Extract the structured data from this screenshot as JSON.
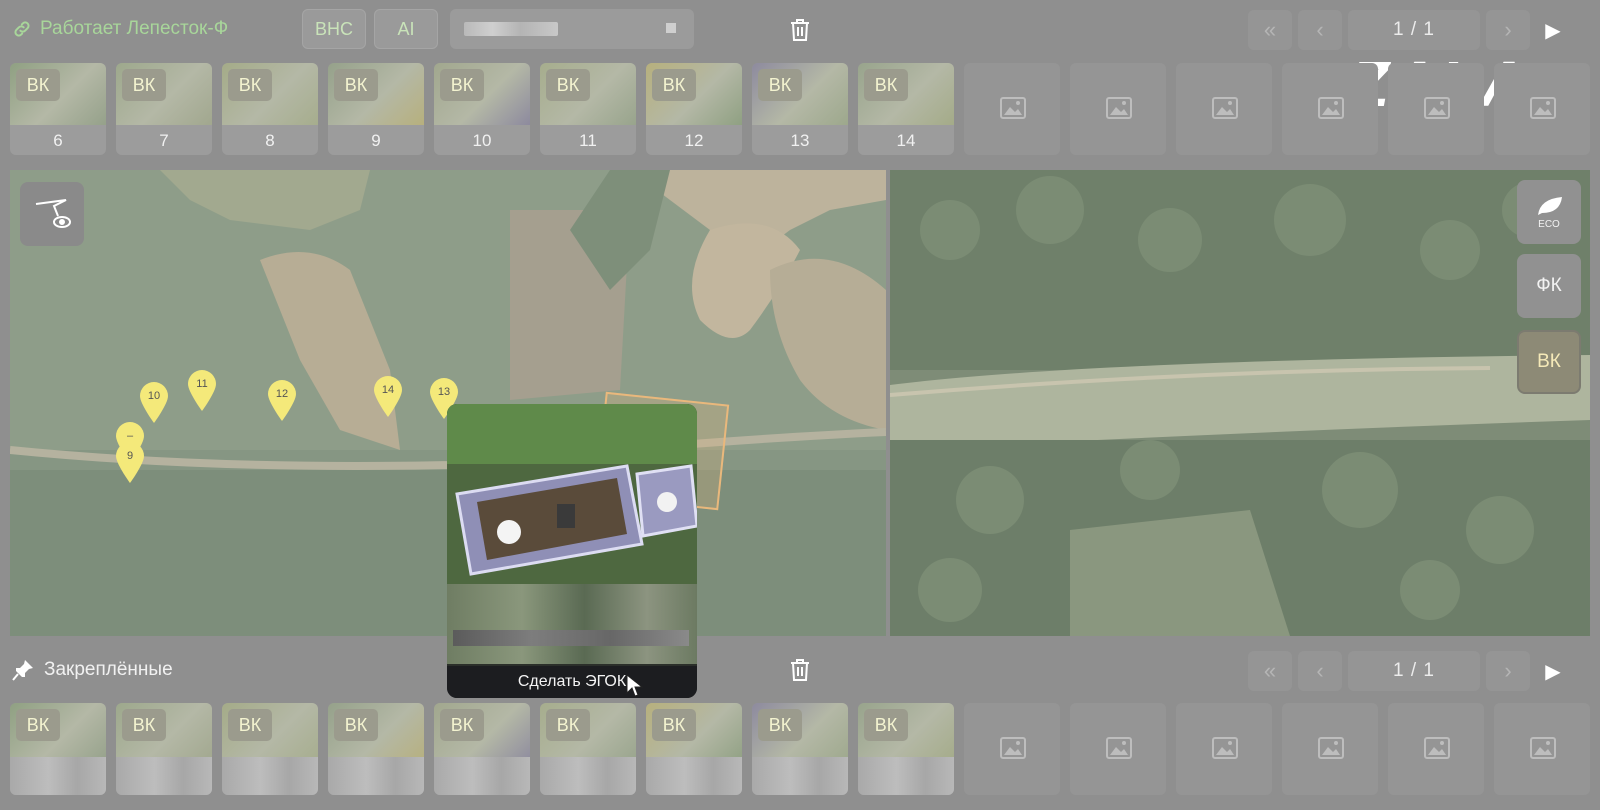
{
  "header": {
    "status_text": "Работает Лепесток-Ф",
    "bnc_label": "ВНС",
    "ai_label": "AI",
    "logo": "ZALA"
  },
  "pager_top": {
    "first": "«",
    "prev": "‹",
    "count": "1 / 1",
    "next": "›",
    "play": "▶"
  },
  "pager_mid": {
    "first": "«",
    "prev": "‹",
    "count": "1 / 1",
    "next": "›",
    "play": "▶"
  },
  "thumbnails_top": [
    {
      "badge": "ВК",
      "num": "6"
    },
    {
      "badge": "ВК",
      "num": "7"
    },
    {
      "badge": "ВК",
      "num": "8"
    },
    {
      "badge": "ВК",
      "num": "9"
    },
    {
      "badge": "ВК",
      "num": "10"
    },
    {
      "badge": "ВК",
      "num": "11"
    },
    {
      "badge": "ВК",
      "num": "12"
    },
    {
      "badge": "ВК",
      "num": "13"
    },
    {
      "badge": "ВК",
      "num": "14"
    }
  ],
  "thumbnails_bottom": [
    {
      "badge": "ВК"
    },
    {
      "badge": "ВК"
    },
    {
      "badge": "ВК"
    },
    {
      "badge": "ВК"
    },
    {
      "badge": "ВК"
    },
    {
      "badge": "ВК"
    },
    {
      "badge": "ВК"
    },
    {
      "badge": "ВК"
    },
    {
      "badge": "ВК"
    }
  ],
  "empty_slots_count": 6,
  "map": {
    "markers": [
      {
        "label": "10"
      },
      {
        "label": "11"
      },
      {
        "label": "12"
      },
      {
        "label": "14"
      },
      {
        "label": "13"
      },
      {
        "label": "–"
      },
      {
        "label": "9"
      }
    ]
  },
  "popup": {
    "button_label": "Сделать ЭГОК"
  },
  "side_buttons": {
    "eco": "ECO",
    "fk": "ФК",
    "vk": "ВК"
  },
  "pinned": {
    "label": "Закреплённые"
  },
  "colors": {
    "accent_green": "#a8d69a",
    "marker_yellow": "#f4e97a",
    "badge_yellow": "#f3f3d0"
  }
}
